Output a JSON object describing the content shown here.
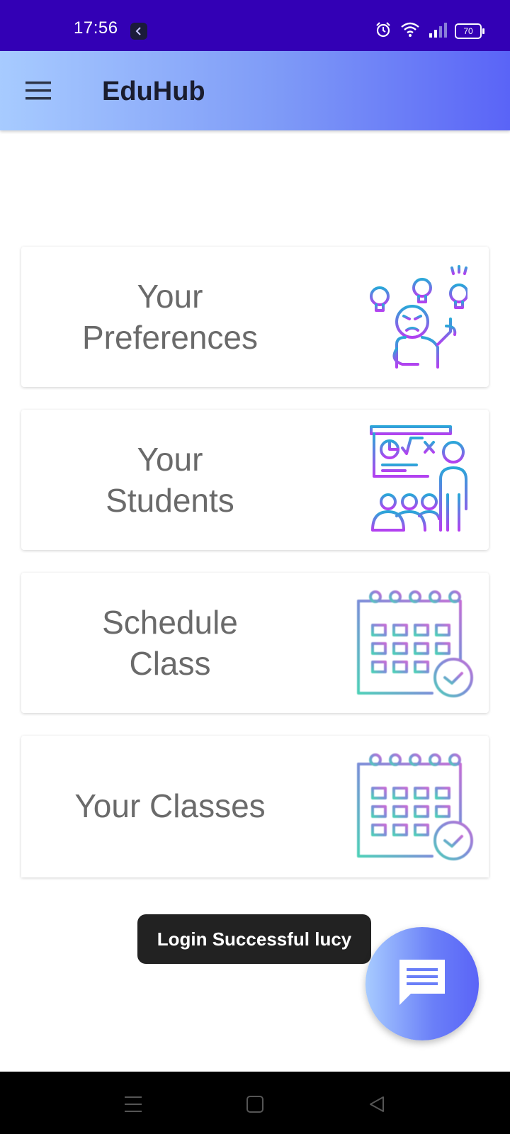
{
  "status_bar": {
    "time": "17:56",
    "battery": "70",
    "icons": [
      "alarm-icon",
      "wifi-icon",
      "signal-icon",
      "battery-icon"
    ]
  },
  "app_bar": {
    "title": "EduHub",
    "menu_icon": "hamburger-menu-icon"
  },
  "cards": [
    {
      "label": "Your\nPreferences",
      "icon": "thinking-person-idea-icon"
    },
    {
      "label": "Your\nStudents",
      "icon": "teacher-classroom-icon"
    },
    {
      "label": "Schedule\nClass",
      "icon": "calendar-check-icon"
    },
    {
      "label": "Your Classes",
      "icon": "calendar-check-icon"
    }
  ],
  "toast": {
    "message": "Login Successful lucy"
  },
  "fab": {
    "icon": "chat-icon"
  },
  "nav_bar": {
    "icons": [
      "recents-icon",
      "home-icon",
      "back-icon"
    ]
  },
  "colors": {
    "status_bar": "#3300b5",
    "gradient_start": "#a7cbff",
    "gradient_end": "#5a64f7",
    "card_text": "#6a6a6a",
    "toast_bg": "#222222"
  }
}
